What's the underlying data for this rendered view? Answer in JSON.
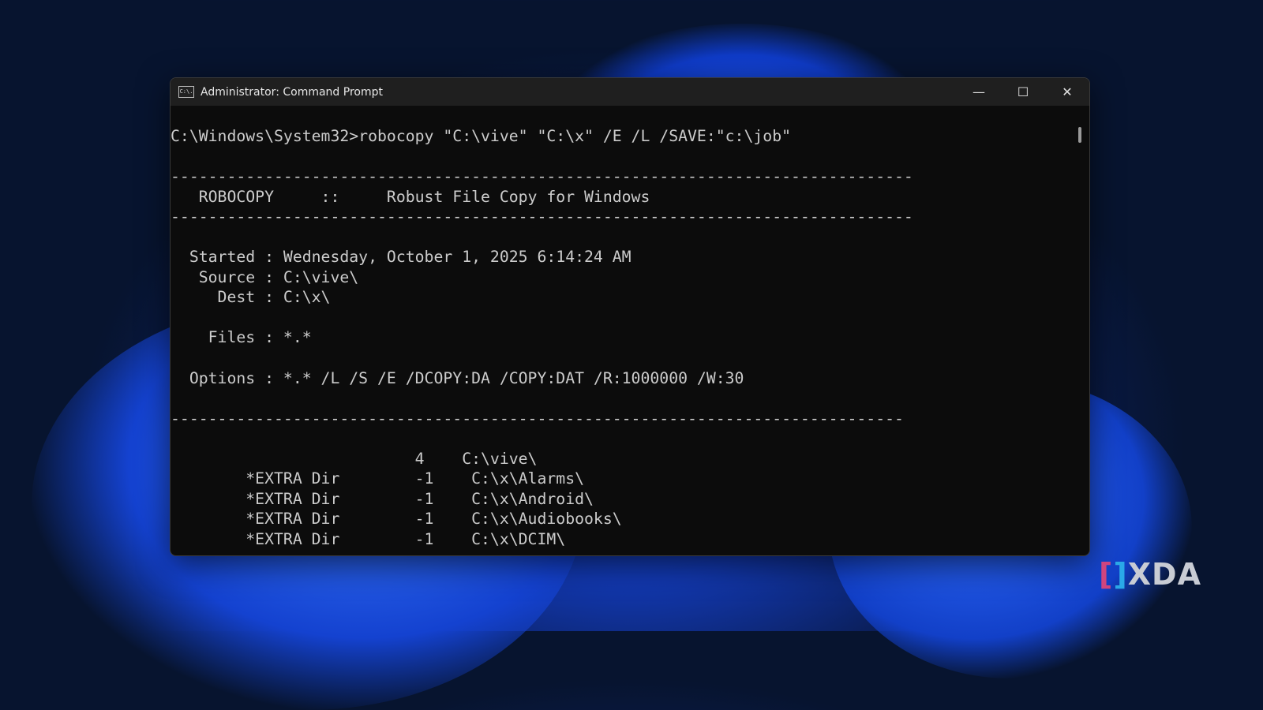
{
  "window": {
    "title": "Administrator: Command Prompt",
    "icon": "cmd-icon",
    "icon_text": "C:\\."
  },
  "controls": {
    "minimize": "—",
    "maximize": "☐",
    "close": "✕"
  },
  "terminal": {
    "lines": [
      "C:\\Windows\\System32>robocopy \"C:\\vive\" \"C:\\x\" /E /L /SAVE:\"c:\\job\"",
      "",
      "-------------------------------------------------------------------------------",
      "   ROBOCOPY     ::     Robust File Copy for Windows",
      "-------------------------------------------------------------------------------",
      "",
      "  Started : Wednesday, October 1, 2025 6:14:24 AM",
      "   Source : C:\\vive\\",
      "     Dest : C:\\x\\",
      "",
      "    Files : *.*",
      "",
      "  Options : *.* /L /S /E /DCOPY:DA /COPY:DAT /R:1000000 /W:30",
      "",
      "------------------------------------------------------------------------------",
      "",
      "                          4    C:\\vive\\",
      "        *EXTRA Dir        -1    C:\\x\\Alarms\\",
      "        *EXTRA Dir        -1    C:\\x\\Android\\",
      "        *EXTRA Dir        -1    C:\\x\\Audiobooks\\",
      "        *EXTRA Dir        -1    C:\\x\\DCIM\\"
    ]
  },
  "watermark": {
    "left": "[",
    "right": "]",
    "text": "XDA"
  }
}
